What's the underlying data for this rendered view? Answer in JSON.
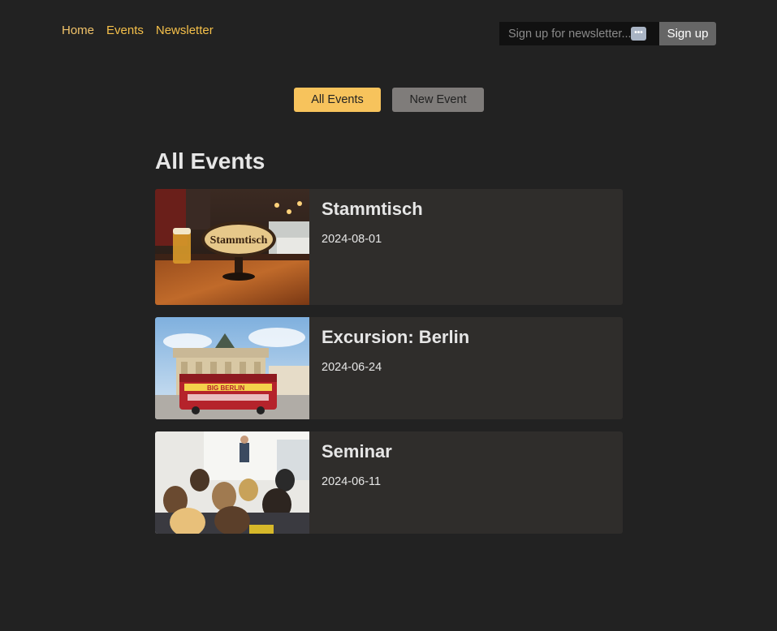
{
  "nav": {
    "items": [
      {
        "label": "Home"
      },
      {
        "label": "Events"
      },
      {
        "label": "Newsletter"
      }
    ]
  },
  "newsletter": {
    "placeholder": "Sign up for newsletter...",
    "button_label": "Sign up",
    "password_badge": "•••"
  },
  "tabs": {
    "all_label": "All Events",
    "new_label": "New Event"
  },
  "main": {
    "heading": "All Events",
    "events": [
      {
        "title": "Stammtisch",
        "date": "2024-08-01",
        "sign_text": "Stammtisch"
      },
      {
        "title": "Excursion: Berlin",
        "date": "2024-06-24",
        "bus_text": "BIG BERLIN"
      },
      {
        "title": "Seminar",
        "date": "2024-06-11"
      }
    ]
  },
  "colors": {
    "background": "#222222",
    "accent": "#f7c35c",
    "card": "#2f2d2b"
  }
}
